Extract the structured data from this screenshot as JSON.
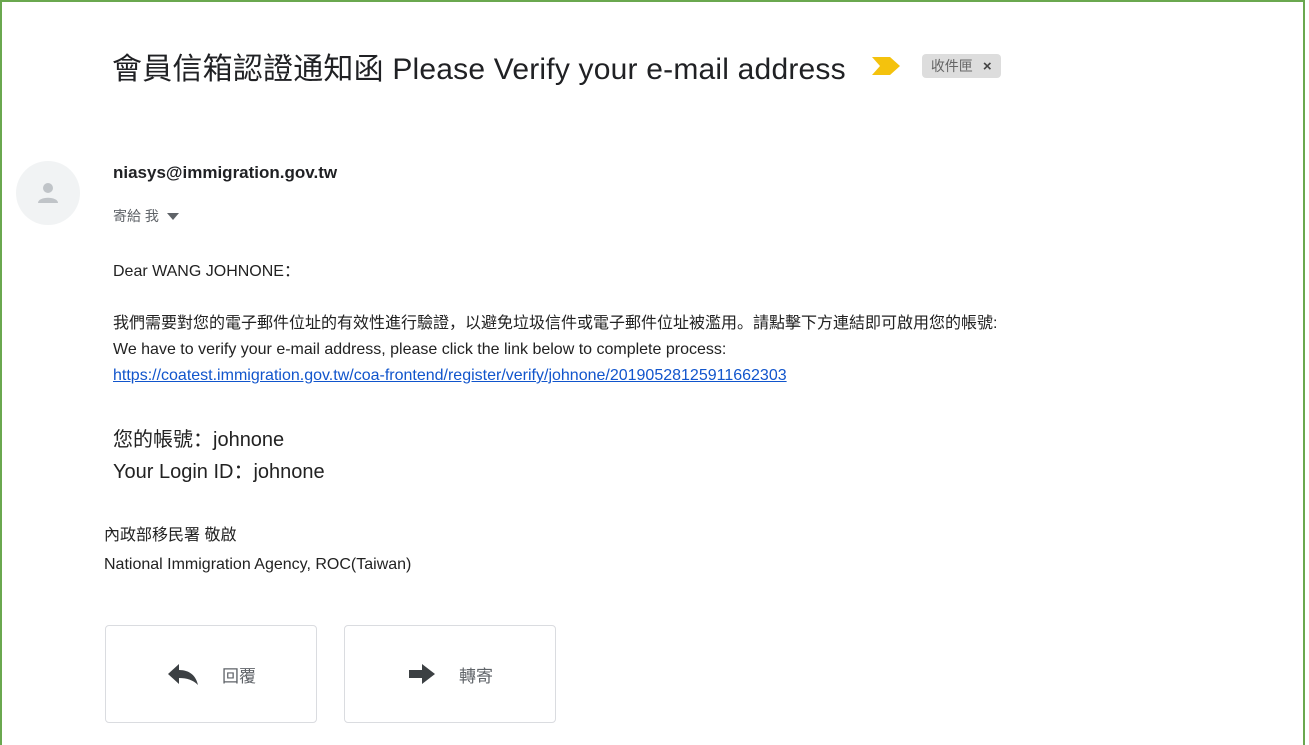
{
  "email": {
    "subject": "會員信箱認證通知函 Please Verify your e-mail address",
    "label_chip": "收件匣",
    "label_chip_close": "×",
    "sender": "niasys@immigration.gov.tw",
    "to": "寄給 我",
    "greeting": "Dear WANG JOHNONE：",
    "body_zh": "我們需要對您的電子郵件位址的有效性進行驗證，以避免垃圾信件或電子郵件位址被濫用。請點擊下方連結即可啟用您的帳號:",
    "body_en": "We have to verify your e-mail address, please click the link below to complete process:",
    "verify_link": "https://coatest.immigration.gov.tw/coa-frontend/register/verify/johnone/20190528125911662303",
    "login_zh": "您的帳號：johnone",
    "login_en": "Your Login ID：johnone",
    "signature_zh": "內政部移民署 敬啟",
    "signature_en": "National Immigration Agency, ROC(Taiwan)"
  },
  "actions": {
    "reply_label": "回覆",
    "forward_label": "轉寄"
  },
  "colors": {
    "frame_border": "#6aa84f",
    "importance_marker": "#f4c20d",
    "link": "#1155cc"
  },
  "icons": {
    "importance": "importance-marker-icon",
    "avatar": "person-icon",
    "reply": "reply-arrow-icon",
    "forward": "forward-arrow-icon",
    "dropdown": "caret-down-icon"
  }
}
